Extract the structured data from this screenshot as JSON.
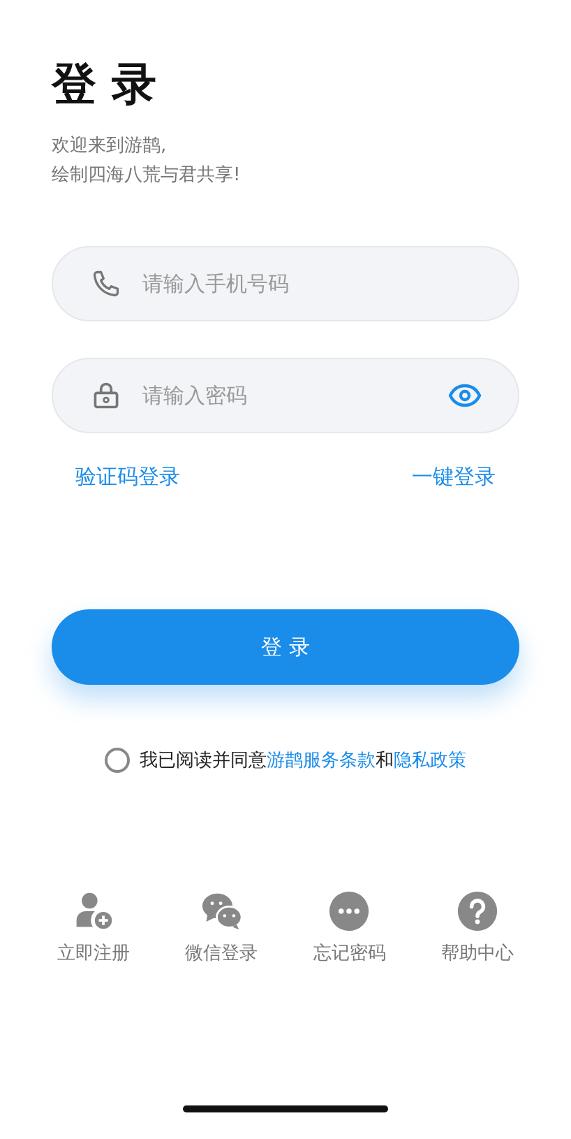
{
  "title": "登 录",
  "subtitle": [
    "欢迎来到游鹊,",
    "绘制四海八荒与君共享!"
  ],
  "fields": [
    {
      "kind": "phone",
      "placeholder": "请输入手机号码"
    },
    {
      "kind": "password",
      "placeholder": "请输入密码"
    }
  ],
  "links": [
    "验证码登录",
    "一键登录"
  ],
  "login_button": "登 录",
  "agreement": {
    "checked": false,
    "parts": [
      {
        "kind": "plain",
        "text": "我已阅读并同意"
      },
      {
        "kind": "link",
        "text": "游鹊服务条款"
      },
      {
        "kind": "plain",
        "text": "和"
      },
      {
        "kind": "link",
        "text": "隐私政策"
      }
    ]
  },
  "actions": [
    {
      "kind": "register",
      "label": "立即注册"
    },
    {
      "kind": "wechat",
      "label": "微信登录"
    },
    {
      "kind": "forgot",
      "label": "忘记密码"
    },
    {
      "kind": "help",
      "label": "帮助中心"
    }
  ]
}
